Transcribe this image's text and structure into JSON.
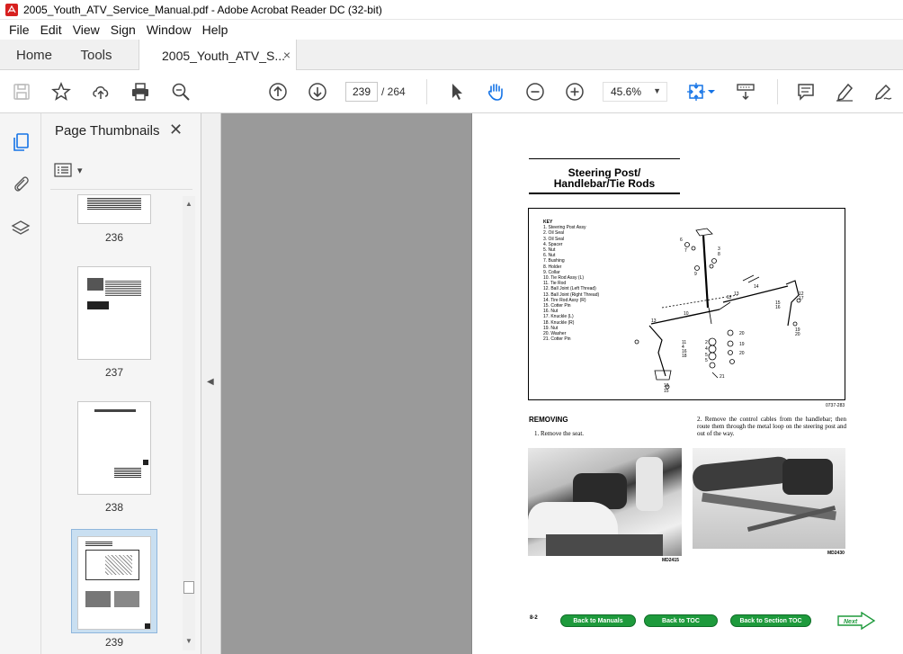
{
  "window": {
    "title": "2005_Youth_ATV_Service_Manual.pdf - Adobe Acrobat Reader DC (32-bit)"
  },
  "menu": [
    "File",
    "Edit",
    "View",
    "Sign",
    "Window",
    "Help"
  ],
  "tabs": {
    "home": "Home",
    "tools": "Tools",
    "document": "2005_Youth_ATV_S...",
    "close": "×"
  },
  "toolbar": {
    "current_page": "239",
    "total_pages": "/  264",
    "zoom": "45.6%",
    "zoom_caret": "▼",
    "colors": {
      "icon": "#444444",
      "accent": "#1473e6"
    }
  },
  "thumbnail_panel": {
    "title": "Page Thumbnails",
    "close": "✕",
    "options_caret": "▾",
    "pages": [
      {
        "label": "236"
      },
      {
        "label": "237"
      },
      {
        "label": "238"
      },
      {
        "label": "239",
        "selected": true
      }
    ]
  },
  "splitter": {
    "arrow": "◀"
  },
  "document": {
    "section_title_line1": "Steering Post/",
    "section_title_line2": "Handlebar/Tie Rods",
    "key_heading": "KEY",
    "key_items": [
      "1.  Steering Post Assy",
      "2.  Oil Seal",
      "3.  Oil Seal",
      "4.  Spacer",
      "5.  Nut",
      "6.  Nut",
      "7.  Bushing",
      "8.  Holder",
      "9.  Collar",
      "10. Tie Rod Assy (L)",
      "11. Tie Rod",
      "12. Ball Joint (Left Thread)",
      "13. Ball Joint (Right Thread)",
      "14. Tire Rod Assy (R)",
      "15. Cotter Pin",
      "16. Nut",
      "17. Knuckle (L)",
      "18. Knuckle (R)",
      "19. Nut",
      "20. Washer",
      "21. Cotter Pin"
    ],
    "figure_code": "0737-283",
    "removing_heading": "REMOVING",
    "step1": "1. Remove the seat.",
    "step2": "2. Remove the control cables from the handlebar; then route them through the metal loop on the steering post and out of the way.",
    "photo1_code": "MD2415",
    "photo2_code": "MD2430",
    "page_number": "8-2",
    "buttons": {
      "back_to_manuals": "Back to Manuals",
      "back_to_toc": "Back to TOC",
      "back_to_section_toc": "Back to Section TOC",
      "next": "Next"
    },
    "colors": {
      "nav_green": "#1e9a3c"
    }
  }
}
